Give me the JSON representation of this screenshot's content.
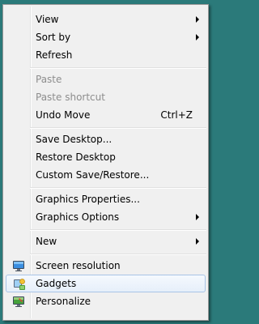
{
  "menu": {
    "items": [
      {
        "label": "View",
        "submenu": true
      },
      {
        "label": "Sort by",
        "submenu": true
      },
      {
        "label": "Refresh"
      },
      {
        "label": "Paste",
        "disabled": true
      },
      {
        "label": "Paste shortcut",
        "disabled": true
      },
      {
        "label": "Undo Move",
        "shortcut": "Ctrl+Z"
      },
      {
        "label": "Save Desktop..."
      },
      {
        "label": "Restore Desktop"
      },
      {
        "label": "Custom Save/Restore..."
      },
      {
        "label": "Graphics Properties..."
      },
      {
        "label": "Graphics Options",
        "submenu": true
      },
      {
        "label": "New",
        "submenu": true
      },
      {
        "label": "Screen resolution",
        "icon": "monitor-icon"
      },
      {
        "label": "Gadgets",
        "icon": "gadgets-icon",
        "highlighted": true
      },
      {
        "label": "Personalize",
        "icon": "personalize-icon"
      }
    ]
  },
  "colors": {
    "desktop_background": "#2b7a7a",
    "menu_background": "#f0f0f0",
    "highlight_border": "#a8c4e6",
    "disabled_text": "#8d8d8d"
  }
}
